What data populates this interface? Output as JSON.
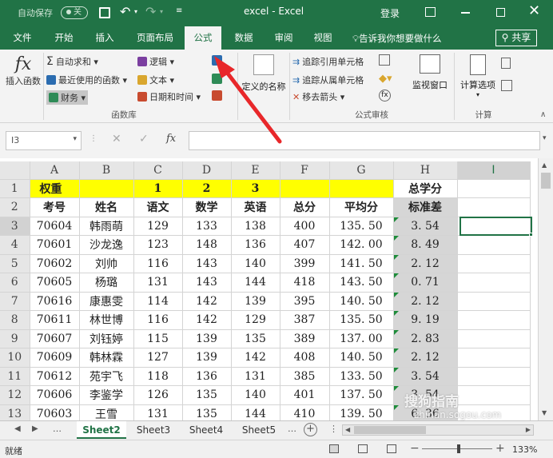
{
  "titlebar": {
    "autosave": "自动保存",
    "autosave_state": "关",
    "title": "excel  -  Excel",
    "login": "登录"
  },
  "tabs": [
    "文件",
    "开始",
    "插入",
    "页面布局",
    "公式",
    "数据",
    "审阅",
    "视图"
  ],
  "active_tab": "公式",
  "tell_me": "告诉我你想要做什么",
  "share": "共享",
  "ribbon": {
    "insert_function": "插入函数",
    "autosum": "自动求和",
    "recent": "最近使用的函数",
    "financial": "财务",
    "logical": "逻辑",
    "text": "文本",
    "datetime": "日期和时间",
    "function_library": "函数库",
    "defined_names": "定义的名称",
    "trace_precedents": "追踪引用单元格",
    "trace_dependents": "追踪从属单元格",
    "remove_arrows": "移去箭头",
    "watch_window": "监视窗口",
    "formula_auditing": "公式审核",
    "calc_options": "计算选项",
    "calculation": "计算"
  },
  "formula_bar": {
    "namebox": "I3",
    "fx": "fx",
    "content": ""
  },
  "columns": [
    "A",
    "B",
    "C",
    "D",
    "E",
    "F",
    "G",
    "H",
    "I"
  ],
  "rows": [
    {
      "n": "1",
      "cells": [
        "权重",
        "",
        "1",
        "2",
        "3",
        "",
        "",
        "总学分",
        ""
      ]
    },
    {
      "n": "2",
      "cells": [
        "考号",
        "姓名",
        "语文",
        "数学",
        "英语",
        "总分",
        "平均分",
        "标准差",
        ""
      ]
    },
    {
      "n": "3",
      "cells": [
        "70604",
        "韩雨萌",
        "129",
        "133",
        "138",
        "400",
        "135. 50",
        "3. 54",
        ""
      ]
    },
    {
      "n": "4",
      "cells": [
        "70601",
        "沙龙逸",
        "123",
        "148",
        "136",
        "407",
        "142. 00",
        "8. 49",
        ""
      ]
    },
    {
      "n": "5",
      "cells": [
        "70602",
        "刘帅",
        "116",
        "143",
        "140",
        "399",
        "141. 50",
        "2. 12",
        ""
      ]
    },
    {
      "n": "6",
      "cells": [
        "70605",
        "杨璐",
        "131",
        "143",
        "144",
        "418",
        "143. 50",
        "0. 71",
        ""
      ]
    },
    {
      "n": "7",
      "cells": [
        "70616",
        "康惠雯",
        "114",
        "142",
        "139",
        "395",
        "140. 50",
        "2. 12",
        ""
      ]
    },
    {
      "n": "8",
      "cells": [
        "70611",
        "林世博",
        "116",
        "142",
        "129",
        "387",
        "135. 50",
        "9. 19",
        ""
      ]
    },
    {
      "n": "9",
      "cells": [
        "70607",
        "刘钰婷",
        "115",
        "139",
        "135",
        "389",
        "137. 00",
        "2. 83",
        ""
      ]
    },
    {
      "n": "10",
      "cells": [
        "70609",
        "韩林霖",
        "127",
        "139",
        "142",
        "408",
        "140. 50",
        "2. 12",
        ""
      ]
    },
    {
      "n": "11",
      "cells": [
        "70612",
        "苑宇飞",
        "118",
        "136",
        "131",
        "385",
        "133. 50",
        "3. 54",
        ""
      ]
    },
    {
      "n": "12",
      "cells": [
        "70606",
        "李鉴学",
        "126",
        "135",
        "140",
        "401",
        "137. 50",
        "3. 54",
        ""
      ]
    },
    {
      "n": "13",
      "cells": [
        "70603",
        "王雪",
        "131",
        "135",
        "144",
        "410",
        "139. 50",
        "6. 36",
        ""
      ]
    }
  ],
  "sheets": [
    "Sheet2",
    "Sheet3",
    "Sheet4",
    "Sheet5"
  ],
  "active_sheet": "Sheet2",
  "status": {
    "ready": "就绪",
    "zoom": "133%"
  },
  "watermark": {
    "line1": "搜狗指南",
    "line2": "zhinan.sogou.com"
  },
  "colors": {
    "excel_green": "#217346",
    "highlight": "#ffff00",
    "arrow": "#e8272a",
    "selected_col": "#d6d6d6"
  }
}
